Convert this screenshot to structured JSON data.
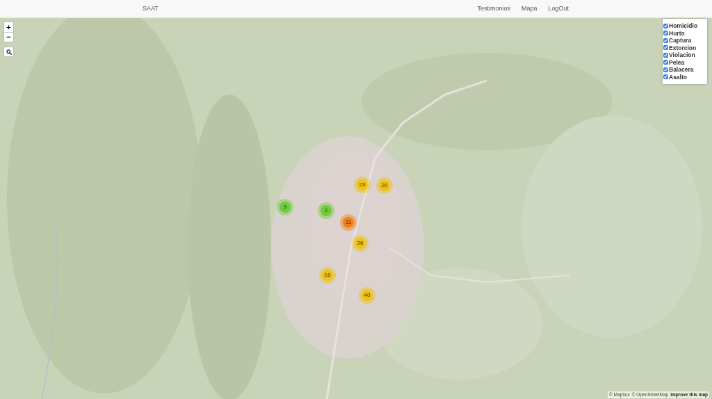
{
  "navbar": {
    "brand": "SAAT",
    "links": [
      {
        "label": "Testimonios"
      },
      {
        "label": "Mapa"
      },
      {
        "label": "LogOut"
      }
    ]
  },
  "map": {
    "zoom_controls": [
      "+",
      "−"
    ],
    "clusters": [
      {
        "count": "23",
        "color": "#f0c20c"
      },
      {
        "count": "20",
        "color": "#f0c20c"
      },
      {
        "count": "9",
        "color": "#6ecc39"
      },
      {
        "count": "2",
        "color": "#6ecc39"
      },
      {
        "count": "11",
        "color": "#f18017"
      },
      {
        "count": "36",
        "color": "#f0c20c"
      },
      {
        "count": "16",
        "color": "#f0c20c"
      },
      {
        "count": "40",
        "color": "#f0c20c"
      }
    ],
    "layer_filter": [
      {
        "label": "Homicidio",
        "checked": true
      },
      {
        "label": "Hurto",
        "checked": true
      },
      {
        "label": "Captura",
        "checked": true
      },
      {
        "label": "Extorcion",
        "checked": true
      },
      {
        "label": "Violacion",
        "checked": true
      },
      {
        "label": "Pelea",
        "checked": true
      },
      {
        "label": "Balacera",
        "checked": true
      },
      {
        "label": "Asalto",
        "checked": true
      }
    ],
    "attribution": [
      {
        "label": "© Mapbox",
        "kind": "credit"
      },
      {
        "label": "© OpenStreetMap",
        "kind": "credit"
      },
      {
        "label": "Improve this map",
        "kind": "feedback"
      }
    ]
  }
}
